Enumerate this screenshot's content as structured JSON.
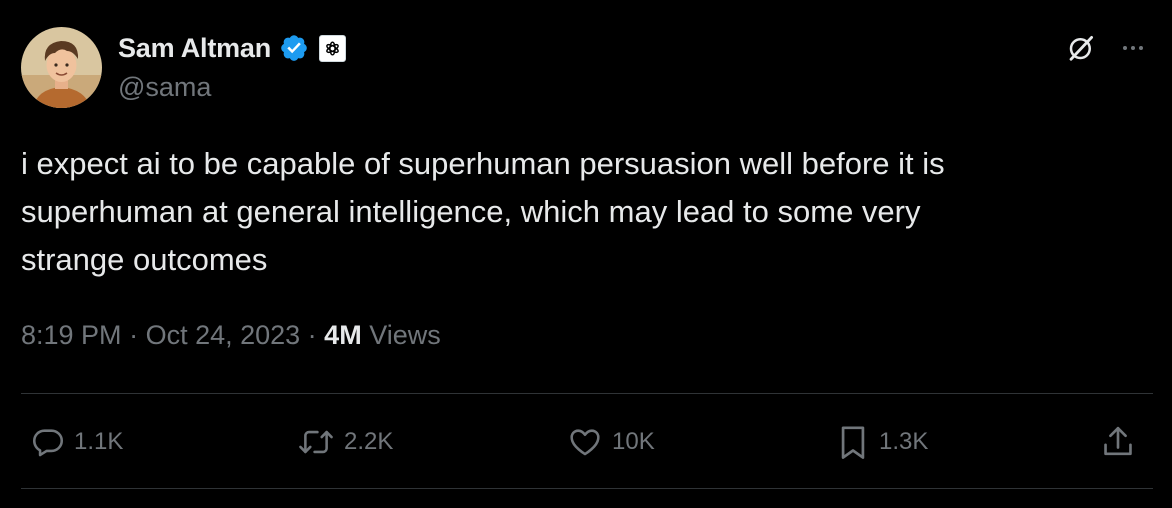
{
  "author": {
    "name": "Sam Altman",
    "handle": "@sama"
  },
  "tweet": {
    "text": "i expect ai to be capable of superhuman persuasion well before it is\nsuperhuman at general intelligence, which may lead to some very\nstrange outcomes"
  },
  "meta": {
    "time": "8:19 PM",
    "separator": " · ",
    "date": "Oct 24, 2023",
    "views_count": "4M",
    "views_label": " Views"
  },
  "actions": {
    "replies": "1.1K",
    "reposts": "2.2K",
    "likes": "10K",
    "bookmarks": "1.3K"
  },
  "icons": {
    "verified": "verified-badge-icon",
    "affiliation": "openai-logo-icon",
    "grok": "grok-icon",
    "more": "more-icon",
    "reply": "reply-icon",
    "repost": "repost-icon",
    "like": "heart-icon",
    "bookmark": "bookmark-icon",
    "share": "share-icon"
  },
  "colors": {
    "background": "#000000",
    "text": "#e7e9ea",
    "secondary": "#71767b",
    "verified": "#1d9bf0",
    "divider": "#2f3336"
  }
}
